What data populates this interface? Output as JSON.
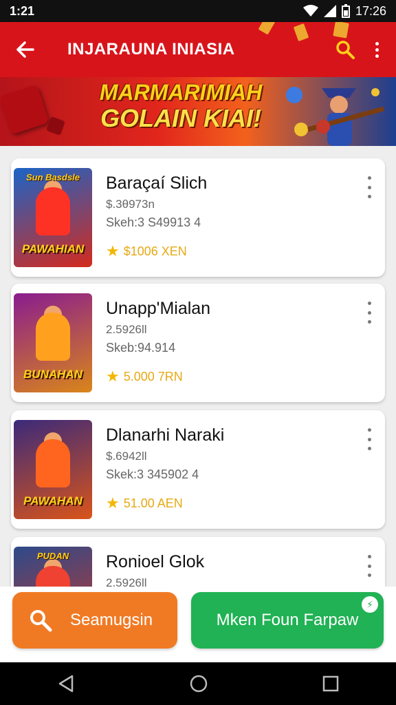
{
  "status_bar": {
    "time_left": "1:21",
    "time_right": "17:26"
  },
  "app_bar": {
    "title": "INJARAUNA INIASIA"
  },
  "banner": {
    "line1": "MARMARIMIAH",
    "line2": "GOLAIN KIAI!"
  },
  "games": [
    {
      "name": "Baraçaí Slich",
      "price": "$.3θ973n",
      "size": "Skeh:3 S49913 4",
      "rating": "$1006 XEN",
      "thumb_top": "Sun Basdsle",
      "thumb_title": "PAWAHIAN",
      "thumb_colors": [
        "#1b64c7",
        "#d42a1e"
      ]
    },
    {
      "name": "Unapp'Mialan",
      "price": "2.5926ll",
      "size": "Skeb:94.914",
      "rating": "5.000 7RN",
      "thumb_top": "",
      "thumb_title": "BUNAHAN",
      "thumb_colors": [
        "#8a1c8f",
        "#d9861a"
      ]
    },
    {
      "name": "Dlanarhi Naraki",
      "price": "$.6942ll",
      "size": "Skek:3 345902 4",
      "rating": "51.00 AEN",
      "thumb_top": "",
      "thumb_title": "PAWAHAN",
      "thumb_colors": [
        "#3b2a7a",
        "#d9541a"
      ]
    },
    {
      "name": "Ronioel Glok",
      "price": "2.5926ll",
      "size": "",
      "rating": "",
      "thumb_top": "PUDAN",
      "thumb_title": "",
      "thumb_colors": [
        "#2d4a8a",
        "#c7372a"
      ]
    }
  ],
  "actions": {
    "search_label": "Seamugsin",
    "open_label": "Mken Foun Farpaw"
  },
  "colors": {
    "app_bar": "#d8141b",
    "search_button": "#f07a24",
    "open_button": "#20b254",
    "rating": "#f2b705"
  }
}
